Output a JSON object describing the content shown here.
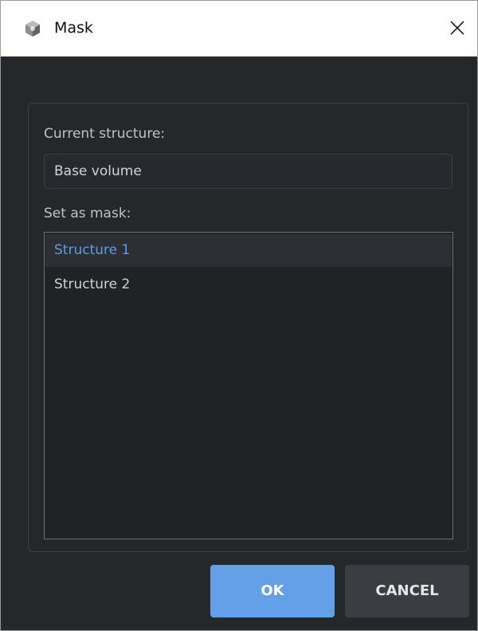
{
  "window": {
    "title": "Mask",
    "app_icon": "cube-app-icon",
    "close_icon": "close-icon"
  },
  "current_structure": {
    "label": "Current structure:",
    "value": "Base volume"
  },
  "mask": {
    "label": "Set as mask:",
    "items": [
      {
        "label": "Structure 1",
        "selected": true
      },
      {
        "label": "Structure 2",
        "selected": false
      }
    ]
  },
  "buttons": {
    "ok_label": "OK",
    "cancel_label": "CANCEL"
  },
  "colors": {
    "background": "#24282b",
    "accent": "#64a0e8",
    "selected_text": "#5e9ae8"
  }
}
